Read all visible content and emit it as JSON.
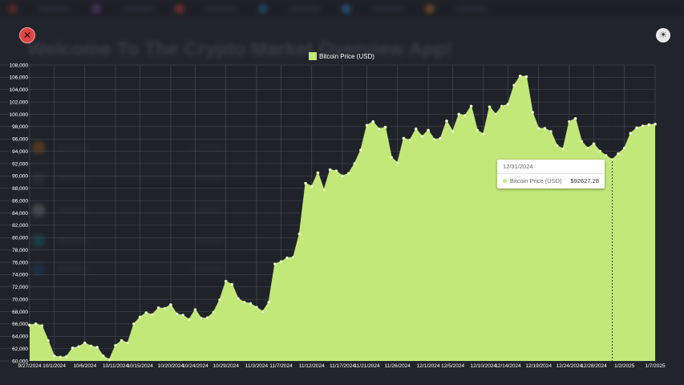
{
  "app": {
    "title": "Welcome To The Crypto Market Overview App!",
    "close_icon": "close-icon",
    "theme_icon": "sun-icon"
  },
  "tooltip": {
    "date": "12/31/2024",
    "series": "Bitcoin Price (USD)",
    "value": "$92627.28"
  },
  "chart_data": {
    "type": "area",
    "legend": "Bitcoin Price (USD)",
    "series_color": "#c2e87a",
    "legend_position": "top-center",
    "grid": true,
    "ylim": [
      60000,
      108000
    ],
    "y_ticks": [
      60000,
      62000,
      64000,
      66000,
      68000,
      70000,
      72000,
      74000,
      76000,
      78000,
      80000,
      82000,
      84000,
      86000,
      88000,
      90000,
      92000,
      94000,
      96000,
      98000,
      100000,
      102000,
      104000,
      106000,
      108000
    ],
    "y_tick_labels": [
      "60,000",
      "62,000",
      "64,000",
      "66,000",
      "68,000",
      "70,000",
      "72,000",
      "74,000",
      "76,000",
      "78,000",
      "80,000",
      "82,000",
      "84,000",
      "86,000",
      "88,000",
      "90,000",
      "92,000",
      "94,000",
      "96,000",
      "98,000",
      "100,000",
      "102,000",
      "104,000",
      "106,000",
      "108,000"
    ],
    "x_tick_labels": [
      "9/27/2024",
      "10/1/2024",
      "10/6/2024",
      "10/11/2024",
      "10/15/2024",
      "10/20/2024",
      "10/24/2024",
      "10/29/2024",
      "11/3/2024",
      "11/7/2024",
      "11/12/2024",
      "11/17/2024",
      "11/21/2024",
      "11/26/2024",
      "12/1/2024",
      "12/5/2024",
      "12/10/2024",
      "12/14/2024",
      "12/19/2024",
      "12/24/2024",
      "12/28/2024",
      "1/2/2025",
      "1/7/2025"
    ],
    "x_tick_index": [
      0,
      4,
      9,
      14,
      18,
      23,
      27,
      32,
      37,
      41,
      46,
      51,
      55,
      60,
      65,
      69,
      74,
      78,
      83,
      88,
      92,
      97,
      102
    ],
    "hover_index": 95,
    "values": [
      65800,
      66000,
      65700,
      63300,
      60800,
      60600,
      60700,
      62100,
      62300,
      62900,
      62400,
      62200,
      60800,
      60200,
      62500,
      63300,
      62900,
      66000,
      67100,
      67800,
      67500,
      68600,
      68500,
      69100,
      67600,
      67400,
      66700,
      68300,
      66900,
      67000,
      67900,
      69900,
      72900,
      72400,
      70100,
      69500,
      69300,
      68700,
      68000,
      69500,
      75700,
      76100,
      76700,
      76800,
      80600,
      88800,
      88300,
      90500,
      87700,
      91000,
      90800,
      90000,
      90400,
      92000,
      94200,
      98200,
      98800,
      97600,
      97900,
      93000,
      92100,
      96100,
      95800,
      97600,
      96400,
      97400,
      95900,
      96100,
      98900,
      97200,
      100000,
      99800,
      101300,
      97400,
      96800,
      101200,
      100000,
      101300,
      101600,
      104700,
      106200,
      106100,
      100300,
      97700,
      97700,
      97200,
      94900,
      94400,
      98800,
      99300,
      95600,
      94500,
      95200,
      94000,
      93300,
      92627,
      93600,
      94500,
      96900,
      97800,
      98100,
      98300,
      98400
    ],
    "dates_domain": "9/27/2024 - 1/7/2025"
  }
}
